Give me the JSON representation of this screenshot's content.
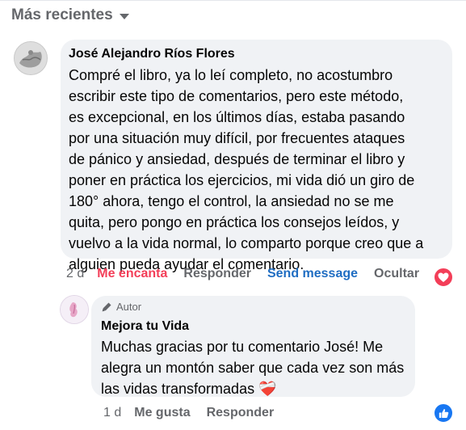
{
  "sort": {
    "label": "Más recientes"
  },
  "comment": {
    "author": "José Alejandro Ríos Flores",
    "text": "Compré el libro, ya lo leí completo, no acostumbro\nescribir este tipo de comentarios, pero este método,\nes excepcional, en los últimos días, estaba pasando\npor una situación muy difícil, por frecuentes ataques\nde pánico y ansiedad, después de terminar el libro y\nponer en práctica los ejercicios, mi vida dió un giro de\n180° ahora, tengo el control, la ansiedad no se me\nquita, pero pongo en práctica los consejos leídos, y\nvuelvo a la vida normal, lo comparto porque creo que a\nalguien pueda ayudar el comentario.",
    "time": "2 d",
    "reaction_label": "Me encanta",
    "reply_label": "Responder",
    "send_label": "Send message",
    "hide_label": "Ocultar",
    "reaction_icon": "heart-icon",
    "colors": {
      "love": "#f33e58",
      "send": "#1f6dc2",
      "bubble": "#f0f2f5"
    }
  },
  "reply": {
    "badge": "Autor",
    "author": "Mejora tu Vida",
    "text": "Muchas gracias por tu comentario José! Me\nalegra un montón saber que cada vez son más\nlas vidas transformadas",
    "emoji": "❤️‍🩹",
    "time": "1 d",
    "like_label": "Me gusta",
    "reply_label": "Responder",
    "reaction_icon": "thumbs-up-icon",
    "colors": {
      "like": "#1877f2"
    }
  }
}
